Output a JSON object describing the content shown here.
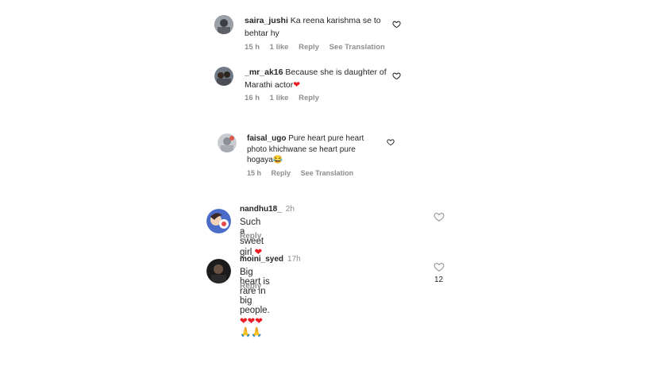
{
  "comments_thread": [
    {
      "username": "saira_jushi",
      "text_line1": "Ka reena karishma se to",
      "text_line2": "behtar hy",
      "time": "15 h",
      "likes": "1 like",
      "reply": "Reply",
      "translate": "See Translation"
    },
    {
      "username": "_mr_ak16",
      "text_line1": "Because she is daughter of",
      "text_line2": "Marathi actor",
      "text_emoji": "❤",
      "time": "16 h",
      "likes": "1 like",
      "reply": "Reply"
    },
    {
      "username": "faisal_ugo",
      "text_line1": "Pure heart pure heart",
      "text_line2": "photo khichwane se heart pure",
      "text_line3": "hogaya",
      "text_emoji": "😂",
      "time": "15 h",
      "reply": "Reply",
      "translate": "See Translation"
    }
  ],
  "comments_main": [
    {
      "username": "nandhu18_",
      "time": "2h",
      "text": "Such a sweet girl",
      "text_emoji": "❤",
      "reply": "Reply"
    },
    {
      "username": "moini_syed",
      "time": "17h",
      "text": "Big heart is rare in big people.",
      "text_emoji": "❤❤❤🙏🙏",
      "reply": "Reply",
      "like_count": "12"
    }
  ],
  "icons": [
    "heart-outline-icon"
  ],
  "colors": {
    "accent_red": "#ed1c24",
    "muted": "#8e8e8e",
    "text": "#262626"
  }
}
